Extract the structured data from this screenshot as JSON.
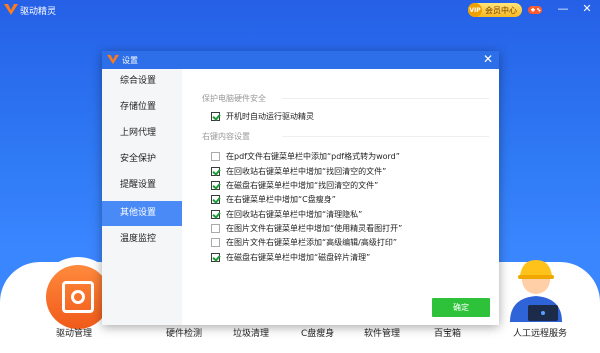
{
  "app": {
    "title": "驱动精灵",
    "vip_label": "会员中心",
    "vip_mark": "VIP",
    "controls": {
      "minimize": "—",
      "close": "✕"
    }
  },
  "bottom_nav": {
    "items": [
      {
        "label": "驱动管理"
      },
      {
        "label": "硬件检测"
      },
      {
        "label": "垃圾清理"
      },
      {
        "label": "C盘瘦身"
      },
      {
        "label": "软件管理"
      },
      {
        "label": "百宝箱"
      },
      {
        "label": "人工远程服务"
      }
    ]
  },
  "dialog": {
    "title": "设置",
    "close": "✕",
    "side_nav": [
      {
        "label": "综合设置"
      },
      {
        "label": "存储位置"
      },
      {
        "label": "上网代理"
      },
      {
        "label": "安全保护"
      },
      {
        "label": "提醒设置"
      },
      {
        "label": "其他设置",
        "active": true
      },
      {
        "label": "温度监控"
      }
    ],
    "sections": {
      "hardware": "保护电脑硬件安全",
      "context_menu": "右键内容设置"
    },
    "options": [
      {
        "label": "开机时自动运行驱动精灵",
        "checked": true
      },
      {
        "label": "在pdf文件右键菜单栏中添加“pdf格式转为word”",
        "checked": false
      },
      {
        "label": "在回收站右键菜单栏中增加“找回清空的文件”",
        "checked": true
      },
      {
        "label": "在磁盘右键菜单栏中增加“找回清空的文件”",
        "checked": true
      },
      {
        "label": "在右键菜单栏中增加“C盘瘦身”",
        "checked": true
      },
      {
        "label": "在回收站右键菜单栏中增加“清理隐私”",
        "checked": true
      },
      {
        "label": "在图片文件右键菜单栏中增加“使用精灵看图打开”",
        "checked": false
      },
      {
        "label": "在图片文件右键菜单栏添加“高级编辑/高级打印”",
        "checked": false
      },
      {
        "label": "在磁盘右键菜单栏中增加“磁盘碎片清理”",
        "checked": true
      }
    ],
    "ok_label": "确定"
  },
  "colors": {
    "brand_blue": "#2d6fe8",
    "active_nav": "#4a8af6",
    "ok_green": "#2ec23a",
    "check_green": "#1e9a38",
    "accent_orange": "#f06a1e"
  }
}
